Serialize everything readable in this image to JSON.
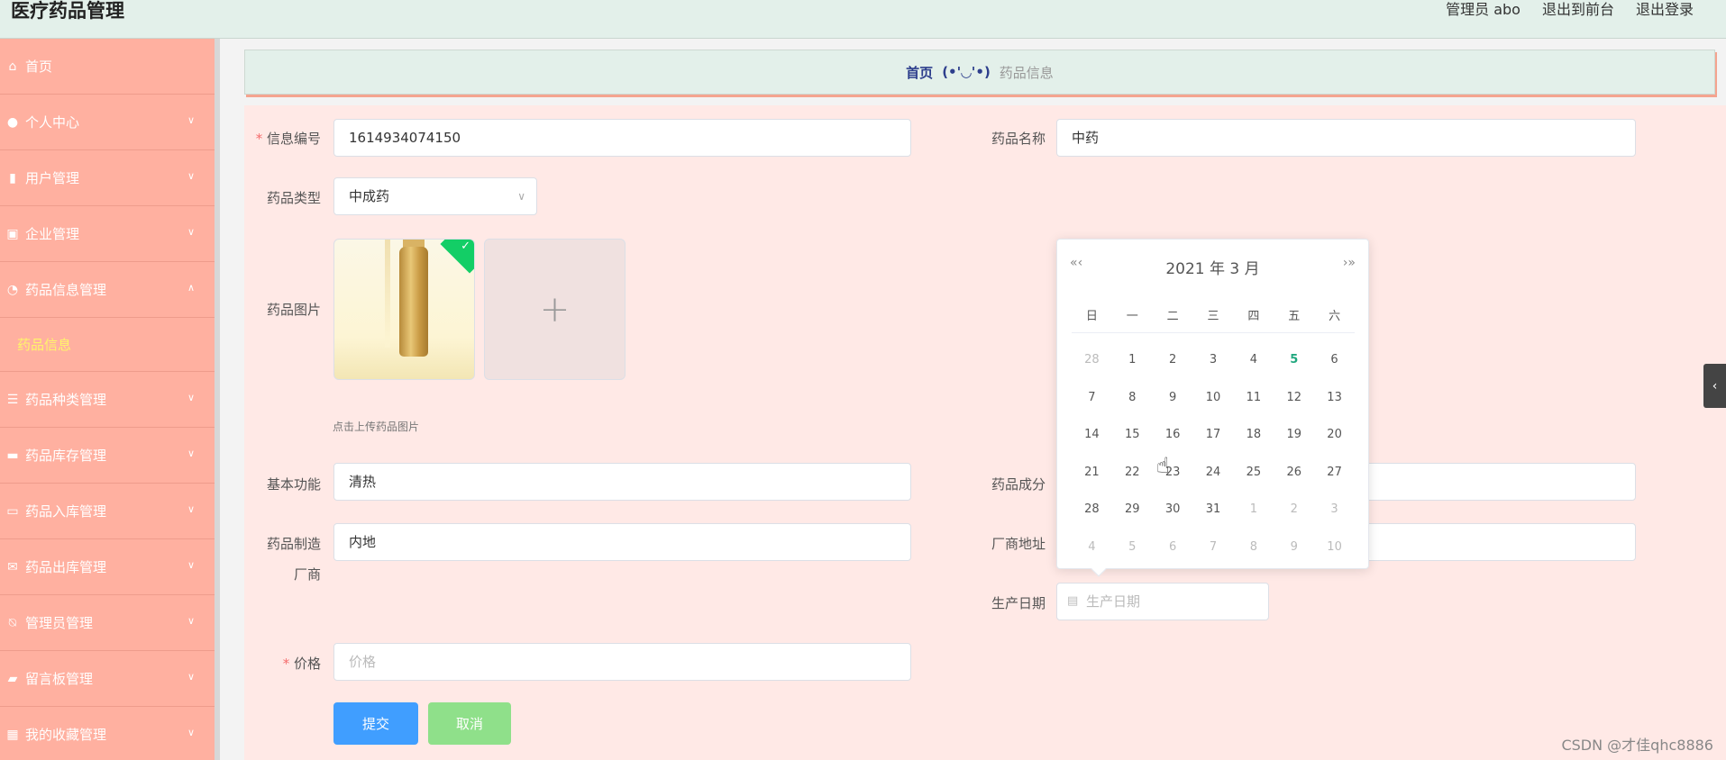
{
  "header": {
    "title": "医疗药品管理",
    "admin_label": "管理员 abo",
    "exit_front": "退出到前台",
    "logout": "退出登录"
  },
  "sidebar": {
    "items": [
      {
        "label": "首页",
        "icon": "home-icon"
      },
      {
        "label": "个人中心",
        "icon": "user-icon"
      },
      {
        "label": "用户管理",
        "icon": "bar-chart-icon"
      },
      {
        "label": "企业管理",
        "icon": "clipboard-icon"
      },
      {
        "label": "药品信息管理",
        "icon": "gauge-icon"
      },
      {
        "label": "药品信息",
        "sub": true
      },
      {
        "label": "药品种类管理",
        "icon": "list-icon"
      },
      {
        "label": "药品库存管理",
        "icon": "briefcase-icon"
      },
      {
        "label": "药品入库管理",
        "icon": "message-icon"
      },
      {
        "label": "药品出库管理",
        "icon": "mail-icon"
      },
      {
        "label": "管理员管理",
        "icon": "bell-off-icon"
      },
      {
        "label": "留言板管理",
        "icon": "chat-icon"
      },
      {
        "label": "我的收藏管理",
        "icon": "grid-icon"
      }
    ]
  },
  "breadcrumb": {
    "home": "首页",
    "separator": "(•'◡'•)",
    "current": "药品信息"
  },
  "form": {
    "info_no_label": "信息编号",
    "info_no_value": "1614934074150",
    "drug_name_label": "药品名称",
    "drug_name_value": "中药",
    "drug_type_label": "药品类型",
    "drug_type_value": "中成药",
    "drug_image_label": "药品图片",
    "upload_hint": "点击上传药品图片",
    "function_label": "基本功能",
    "function_value": "清热",
    "ingredient_label": "药品成分",
    "manufacturer_label_1": "药品制造",
    "manufacturer_label_2": "厂商",
    "manufacturer_value": "内地",
    "address_label": "厂商地址",
    "prod_date_label": "生产日期",
    "prod_date_placeholder": "生产日期",
    "price_label": "价格",
    "price_placeholder": "价格",
    "submit": "提交",
    "cancel": "取消"
  },
  "datepicker": {
    "title": "2021 年  3 月",
    "prev": "«‹",
    "next": "›»",
    "weekdays": [
      "日",
      "一",
      "二",
      "三",
      "四",
      "五",
      "六"
    ],
    "days": [
      {
        "d": "28",
        "t": "other"
      },
      {
        "d": "1"
      },
      {
        "d": "2"
      },
      {
        "d": "3"
      },
      {
        "d": "4"
      },
      {
        "d": "5",
        "t": "today"
      },
      {
        "d": "6"
      },
      {
        "d": "7"
      },
      {
        "d": "8"
      },
      {
        "d": "9"
      },
      {
        "d": "10"
      },
      {
        "d": "11"
      },
      {
        "d": "12"
      },
      {
        "d": "13"
      },
      {
        "d": "14"
      },
      {
        "d": "15"
      },
      {
        "d": "16"
      },
      {
        "d": "17"
      },
      {
        "d": "18"
      },
      {
        "d": "19"
      },
      {
        "d": "20"
      },
      {
        "d": "21"
      },
      {
        "d": "22"
      },
      {
        "d": "23"
      },
      {
        "d": "24"
      },
      {
        "d": "25"
      },
      {
        "d": "26"
      },
      {
        "d": "27"
      },
      {
        "d": "28"
      },
      {
        "d": "29"
      },
      {
        "d": "30"
      },
      {
        "d": "31"
      },
      {
        "d": "1",
        "t": "other"
      },
      {
        "d": "2",
        "t": "other"
      },
      {
        "d": "3",
        "t": "other"
      },
      {
        "d": "4",
        "t": "other"
      },
      {
        "d": "5",
        "t": "other"
      },
      {
        "d": "6",
        "t": "other"
      },
      {
        "d": "7",
        "t": "other"
      },
      {
        "d": "8",
        "t": "other"
      },
      {
        "d": "9",
        "t": "other"
      },
      {
        "d": "10",
        "t": "other"
      }
    ]
  },
  "watermark": "CSDN @才佳qhc8886",
  "colors": {
    "sidebar_bg": "#ffb0a0",
    "header_bg": "#e3f0ea",
    "form_bg": "#ffe9e6",
    "primary": "#409eff",
    "success": "#8fe08a",
    "active_sub": "#fff56a"
  }
}
